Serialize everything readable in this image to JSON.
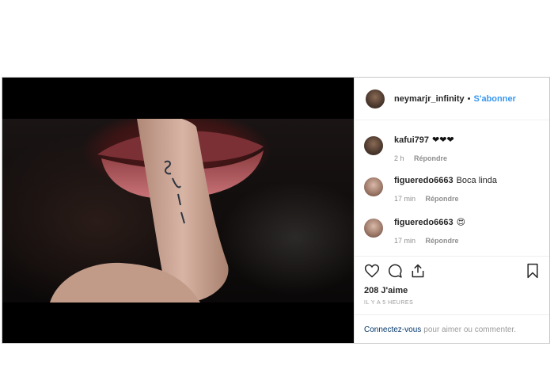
{
  "post": {
    "author": "neymarjr_infinity",
    "separator": "•",
    "follow_label": "S'abonner",
    "likes": "208 J'aime",
    "time_ago": "IL Y A 5 HEURES",
    "login_link": "Connectez-vous",
    "login_rest": "pour aimer ou commenter."
  },
  "comments": [
    {
      "user": "kafui797",
      "text": "❤❤❤",
      "time": "2 h",
      "reply": "Répondre"
    },
    {
      "user": "figueredo6663",
      "text": "Boca linda",
      "time": "17 min",
      "reply": "Répondre"
    },
    {
      "user": "figueredo6663",
      "text": "😍",
      "time": "17 min",
      "reply": "Répondre"
    }
  ],
  "icons": [
    "heart-icon",
    "comment-icon",
    "share-icon",
    "bookmark-icon"
  ]
}
